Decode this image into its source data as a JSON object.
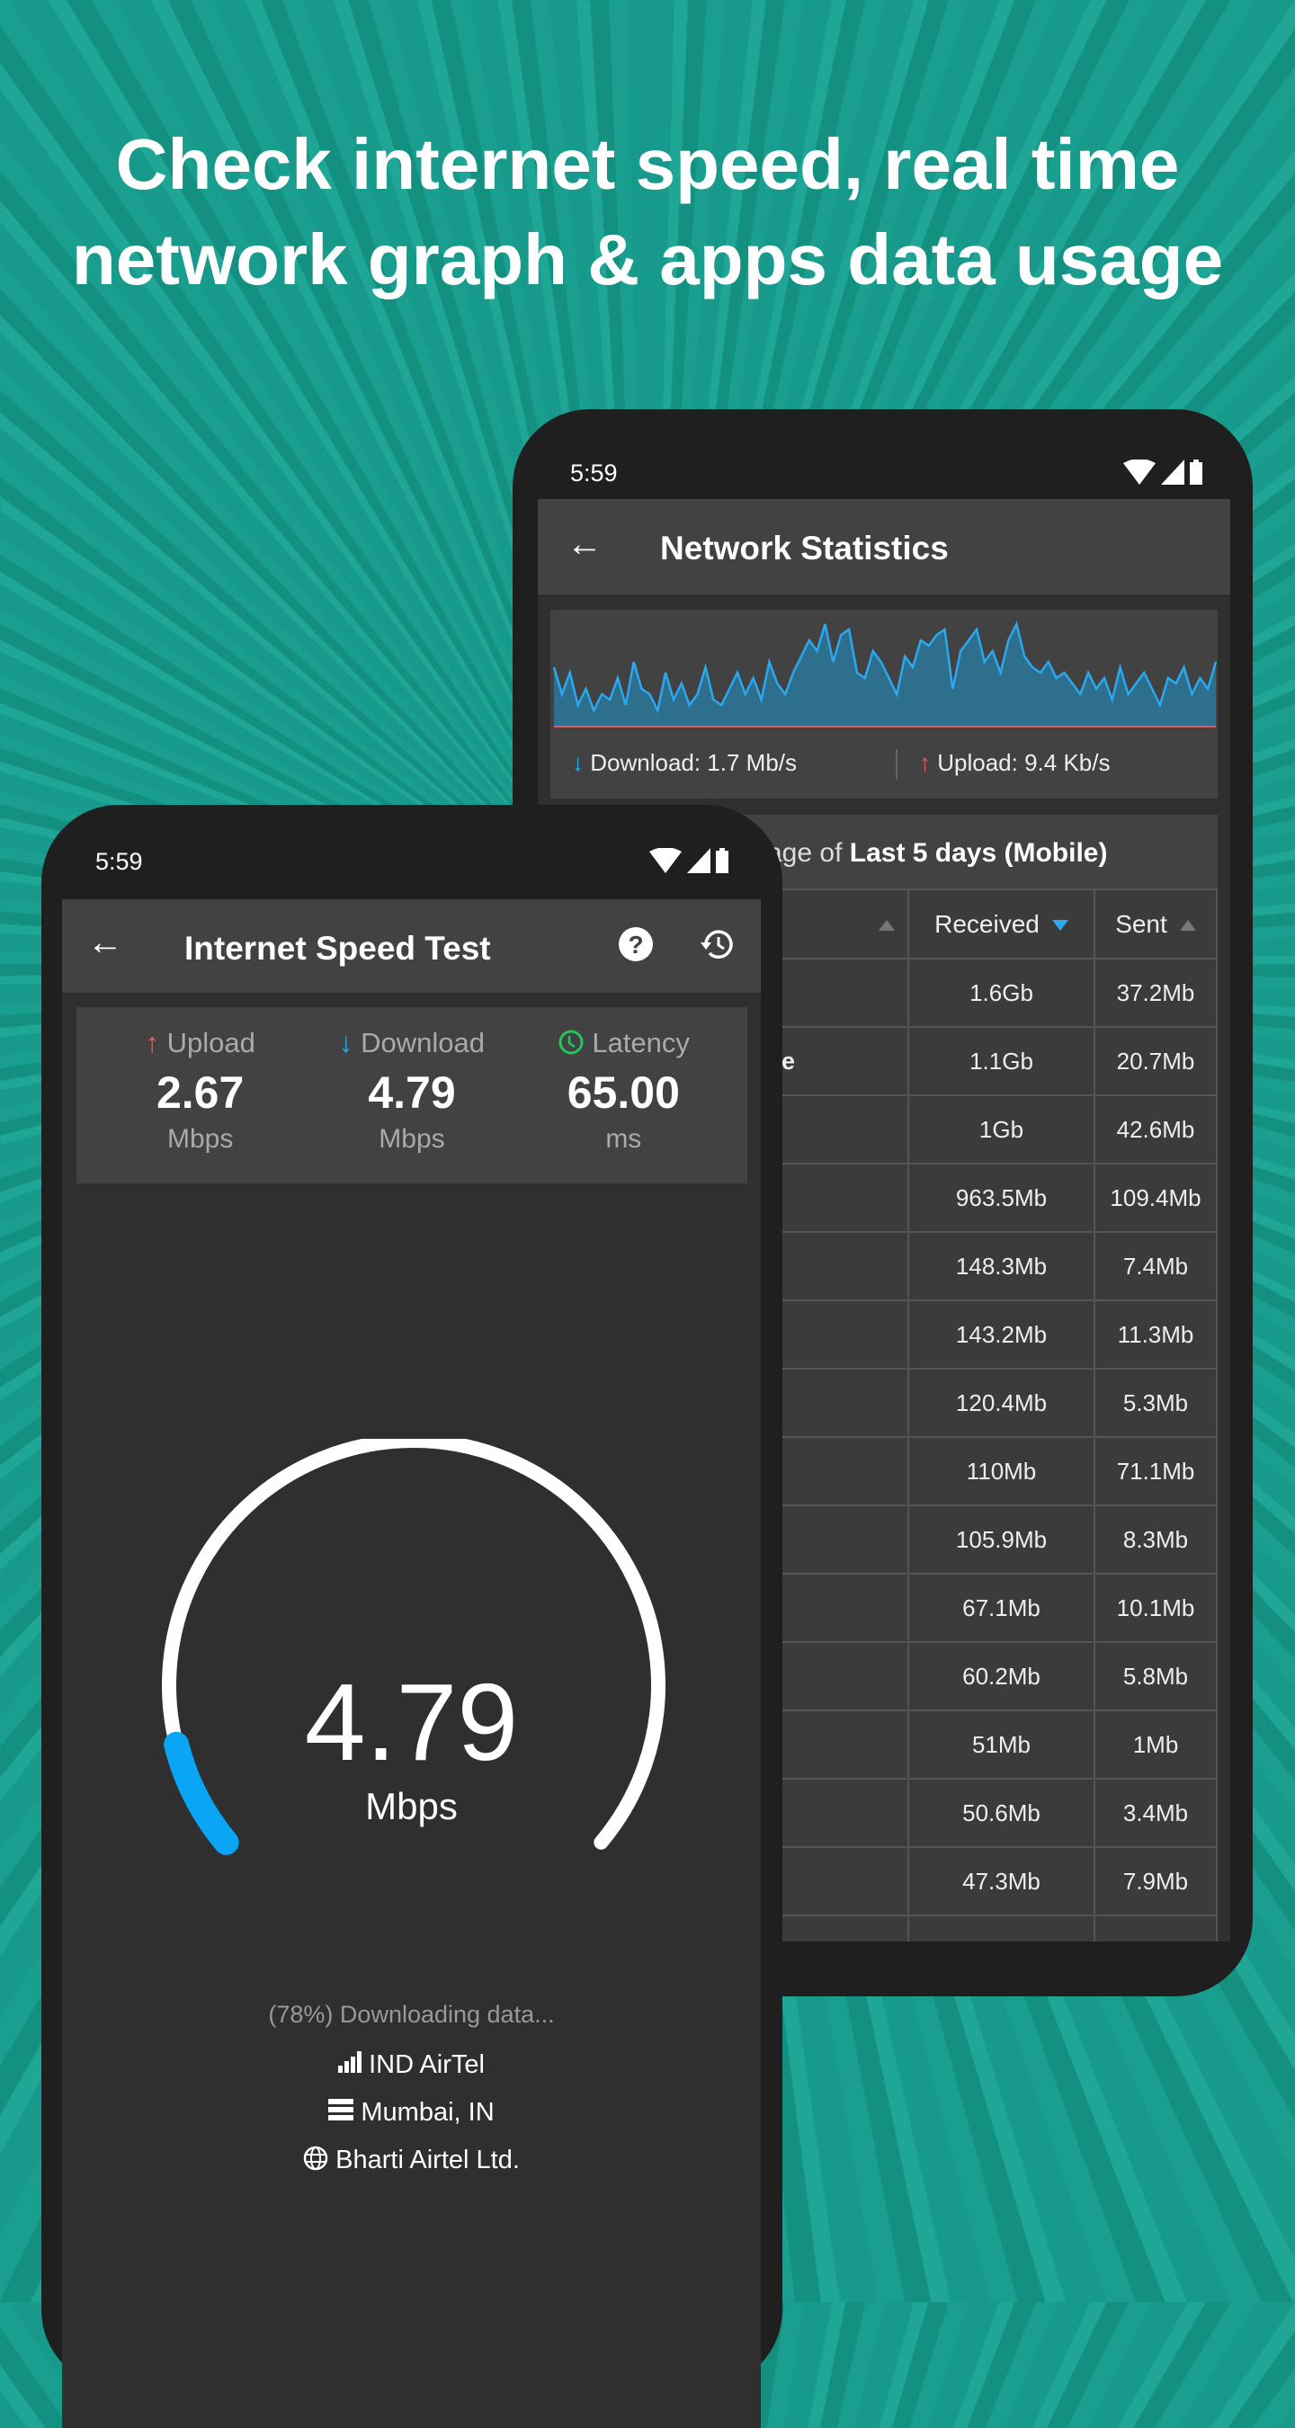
{
  "headline": {
    "line1": "Check internet speed, real time",
    "line2": "network graph & apps data usage"
  },
  "stats_screen": {
    "status_time": "5:59",
    "title": "Network Statistics",
    "graph": {
      "download_color": "#29a9f0",
      "upload_color": "#e85b5b",
      "download_trace": [
        0.55,
        0.3,
        0.5,
        0.2,
        0.35,
        0.15,
        0.3,
        0.25,
        0.45,
        0.2,
        0.6,
        0.35,
        0.3,
        0.15,
        0.5,
        0.25,
        0.4,
        0.2,
        0.3,
        0.55,
        0.25,
        0.2,
        0.35,
        0.5,
        0.3,
        0.45,
        0.25,
        0.6,
        0.4,
        0.3,
        0.5,
        0.65,
        0.8,
        0.7,
        0.95,
        0.6,
        0.85,
        0.9,
        0.5,
        0.45,
        0.7,
        0.6,
        0.45,
        0.3,
        0.65,
        0.55,
        0.8,
        0.75,
        0.85,
        0.9,
        0.35,
        0.7,
        0.8,
        0.9,
        0.6,
        0.7,
        0.5,
        0.8,
        0.95,
        0.65,
        0.55,
        0.5,
        0.6,
        0.45,
        0.5,
        0.4,
        0.3,
        0.5,
        0.35,
        0.45,
        0.25,
        0.55,
        0.3,
        0.4,
        0.5,
        0.35,
        0.2,
        0.45,
        0.4,
        0.55,
        0.3,
        0.45,
        0.35,
        0.6
      ]
    },
    "download_label": "Download: 1.7 Mb/s",
    "upload_label": "Upload: 9.4 Kb/s",
    "usage_prefix": "sage of ",
    "usage_period": "Last 5 days (Mobile)",
    "columns": {
      "received": "Received",
      "sent": "Sent"
    },
    "rows": [
      {
        "app": "",
        "received": "1.6Gb",
        "sent": "37.2Mb"
      },
      {
        "app": "ore",
        "received": "1.1Gb",
        "sent": "20.7Mb"
      },
      {
        "app": "",
        "received": "1Gb",
        "sent": "42.6Mb"
      },
      {
        "app": "",
        "received": "963.5Mb",
        "sent": "109.4Mb"
      },
      {
        "app": "",
        "received": "148.3Mb",
        "sent": "7.4Mb"
      },
      {
        "app": "",
        "received": "143.2Mb",
        "sent": "11.3Mb"
      },
      {
        "app": "",
        "received": "120.4Mb",
        "sent": "5.3Mb"
      },
      {
        "app": "",
        "received": "110Mb",
        "sent": "71.1Mb"
      },
      {
        "app": "",
        "received": "105.9Mb",
        "sent": "8.3Mb"
      },
      {
        "app": "",
        "received": "67.1Mb",
        "sent": "10.1Mb"
      },
      {
        "app": "",
        "received": "60.2Mb",
        "sent": "5.8Mb"
      },
      {
        "app": "",
        "received": "51Mb",
        "sent": "1Mb"
      },
      {
        "app": "",
        "received": "50.6Mb",
        "sent": "3.4Mb"
      },
      {
        "app": "",
        "received": "47.3Mb",
        "sent": "7.9Mb"
      }
    ]
  },
  "speed_screen": {
    "status_time": "5:59",
    "title": "Internet Speed Test",
    "upload": {
      "label": "Upload",
      "value": "2.67",
      "unit": "Mbps"
    },
    "download": {
      "label": "Download",
      "value": "4.79",
      "unit": "Mbps"
    },
    "latency": {
      "label": "Latency",
      "value": "65.00",
      "unit": "ms"
    },
    "gauge": {
      "value": "4.79",
      "unit": "Mbps",
      "fill_fraction": 0.1,
      "accent": "#0aa6f5"
    },
    "progress_text": "(78%) Downloading data...",
    "operator": "IND AirTel",
    "server": "Mumbai, IN",
    "isp": "Bharti Airtel Ltd."
  }
}
